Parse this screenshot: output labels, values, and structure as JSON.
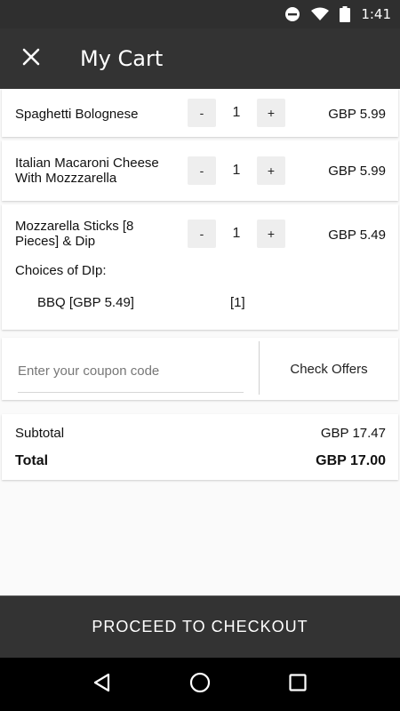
{
  "status_bar": {
    "time": "1:41"
  },
  "app_bar": {
    "title": "My Cart"
  },
  "cart_items": [
    {
      "name": "Spaghetti Bolognese",
      "quantity": "1",
      "price": "GBP 5.99",
      "minus": "-",
      "plus": "+"
    },
    {
      "name": "Italian Macaroni Cheese With Mozzzarella",
      "quantity": "1",
      "price": "GBP 5.99",
      "minus": "-",
      "plus": "+"
    },
    {
      "name": "Mozzarella Sticks [8 Pieces] & Dip",
      "quantity": "1",
      "price": "GBP 5.49",
      "minus": "-",
      "plus": "+",
      "choices_label": "Choices of DIp:",
      "choice": {
        "name": "BBQ [GBP 5.49]",
        "quantity": "[1]"
      }
    }
  ],
  "coupon": {
    "placeholder": "Enter your coupon code",
    "value": "",
    "check_offers_label": "Check Offers"
  },
  "summary": {
    "subtotal_label": "Subtotal",
    "subtotal_value": "GBP 17.47",
    "total_label": "Total",
    "total_value": "GBP 17.00"
  },
  "checkout": {
    "label": "PROCEED TO CHECKOUT"
  },
  "colors": {
    "app_bar": "#333333",
    "status_bar": "#2f2f2f",
    "qty_button": "#eeeeee",
    "nav_bar": "#000000"
  },
  "icons": {
    "close": "close-icon",
    "back": "back-triangle-icon",
    "home": "home-circle-icon",
    "recents": "recents-square-icon"
  }
}
